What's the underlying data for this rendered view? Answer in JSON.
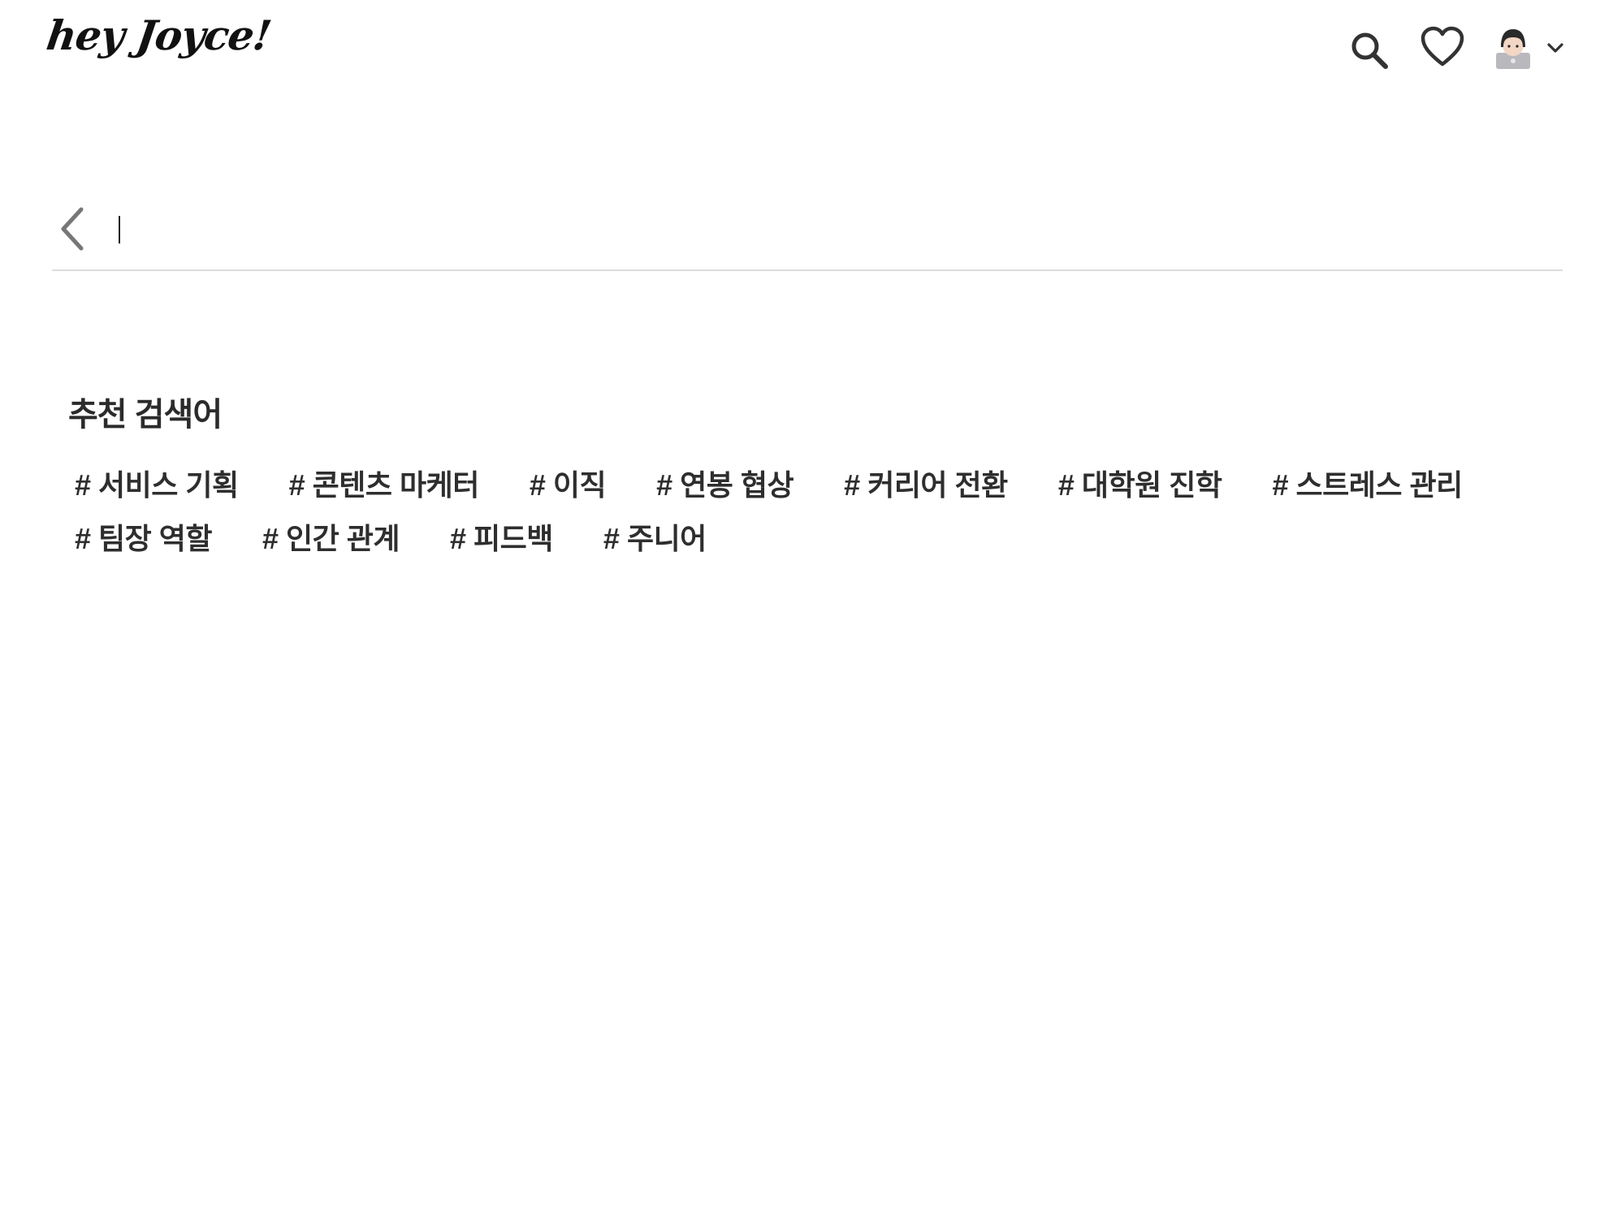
{
  "header": {
    "logo_text": "hey Joyce!",
    "icons": [
      "search-icon",
      "heart-icon",
      "avatar",
      "chevron-down-icon"
    ]
  },
  "search": {
    "value": "",
    "placeholder": ""
  },
  "recommended": {
    "title": "추천 검색어",
    "rows": [
      [
        "# 서비스 기획",
        "# 콘텐츠 마케터",
        "# 이직",
        "# 연봉 협상",
        "# 커리어 전환",
        "# 대학원 진학",
        "# 스트레스 관리"
      ],
      [
        "# 팀장 역할",
        "# 인간 관계",
        "# 피드백",
        "# 주니어"
      ]
    ]
  },
  "colors": {
    "text": "#2e2e2e",
    "divider": "#dcdcdc",
    "icon": "#333333",
    "back_arrow": "#777777"
  }
}
